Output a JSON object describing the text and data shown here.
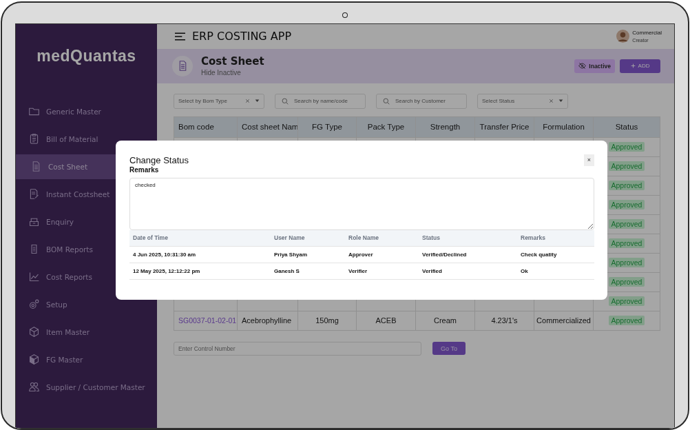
{
  "sidebar": {
    "logo": "medQuantas",
    "items": [
      {
        "label": "Generic Master",
        "selected": false
      },
      {
        "label": "Bill of Material",
        "selected": false
      },
      {
        "label": "Cost Sheet",
        "selected": true
      },
      {
        "label": "Instant Costsheet",
        "selected": false
      },
      {
        "label": "Enquiry",
        "selected": false
      },
      {
        "label": "BOM Reports",
        "selected": false
      },
      {
        "label": "Cost Reports",
        "selected": false
      },
      {
        "label": "Setup",
        "selected": false
      },
      {
        "label": "Item Master",
        "selected": false
      },
      {
        "label": "FG Master",
        "selected": false
      },
      {
        "label": "Supplier / Customer Master",
        "selected": false
      }
    ]
  },
  "top_bar": {
    "title": "ERP COSTING APP",
    "user_name": "Commercial",
    "user_role": "Creator"
  },
  "page_header": {
    "title": "Cost Sheet",
    "subtitle": "Hide Inactive",
    "buttons": [
      {
        "kind": "inactive",
        "label": "Inactive"
      },
      {
        "kind": "add",
        "label": "ADD"
      }
    ]
  },
  "filters": [
    {
      "kind": "select",
      "placeholder": "Select by Bom Type"
    },
    {
      "kind": "search",
      "placeholder": "Search by name/code"
    },
    {
      "kind": "search",
      "placeholder": "Search by Customer"
    },
    {
      "kind": "select",
      "placeholder": "Select Status"
    }
  ],
  "table": {
    "columns": [
      "Bom code",
      "Cost sheet Nam",
      "FG Type",
      "Pack Type",
      "Strength",
      "Transfer Price",
      "Formulation",
      "Status"
    ],
    "rows": [
      {
        "status": "Approved"
      },
      {
        "status": "Approved"
      },
      {
        "status": "Approved"
      },
      {
        "status": "Approved"
      },
      {
        "status": "Approved"
      },
      {
        "status": "Approved"
      },
      {
        "status": "Approved"
      },
      {
        "status": "Approved"
      },
      {
        "status": "Approved"
      },
      {
        "cells": [
          "SG0037-01-02-01",
          "Acebrophylline",
          "150mg",
          "ACEB",
          "Cream",
          "4.23/1's",
          "Commercialized"
        ],
        "status": "Approved"
      }
    ]
  },
  "control_number": {
    "placeholder": "Enter Control Number",
    "button": "Go To"
  },
  "modal": {
    "title": "Change Status",
    "close": "×",
    "remarks_label": "Remarks",
    "remarks_value": "checked",
    "history": {
      "columns": [
        "Date of Time",
        "User Name",
        "Role Name",
        "Status",
        "Remarks"
      ],
      "rows": [
        [
          "4 Jun 2025, 10:31:30 am",
          "Priya Shyam",
          "Approver",
          "Verified/Declined",
          "Check quatity"
        ],
        [
          "12 May 2025, 12:12:22 pm",
          "Ganesh S",
          "Verifier",
          "Verified",
          "Ok"
        ]
      ]
    }
  }
}
